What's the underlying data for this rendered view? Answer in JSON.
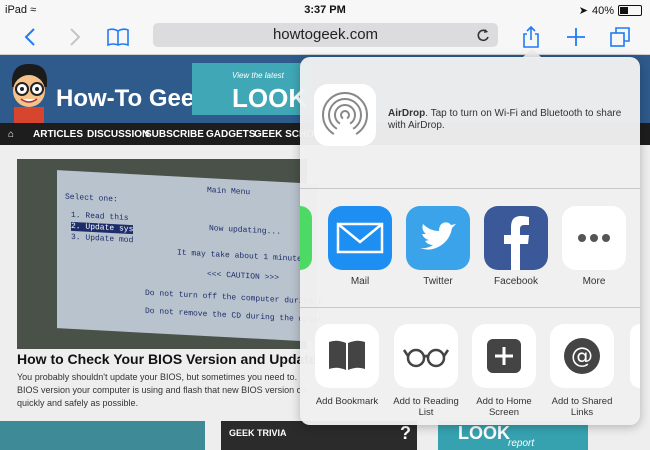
{
  "status": {
    "device": "iPad",
    "time": "3:37 PM",
    "battery": "40%",
    "battery_level": 0.4
  },
  "browser": {
    "url": "howtogeek.com",
    "icons": [
      "chevron-left-icon",
      "chevron-right-icon",
      "bookmarks-icon",
      "reload-icon",
      "share-icon",
      "plus-icon",
      "tabs-icon"
    ]
  },
  "site": {
    "logo": "How-To Geek",
    "banner_small": "View the latest",
    "banner_big": "LOOK",
    "menu": [
      "ARTICLES",
      "DISCUSSION",
      "SUBSCRIBE",
      "GADGETS",
      "GEEK SCHOOL"
    ],
    "article_title": "How to Check Your BIOS Version and Update it",
    "article_body": "You probably shouldn't update your BIOS, but sometimes you need to. BIOS version your computer is using and flash that new BIOS version on quickly and safely as possible.",
    "trivia_label": "GEEK TRIVIA",
    "trivia_mark": "?",
    "promo_title": "LOOK",
    "promo_sub": "report",
    "screen_lines": [
      "Main Menu",
      "Select one:",
      "1. Read this",
      "2. Update sys",
      "3. Update mod",
      "Now updating...",
      "It may take about 1 minute.",
      "<<< CAUTION >>>",
      "Do not turn off the computer during t",
      "Do not remove the CD during the updat"
    ]
  },
  "share_sheet": {
    "airdrop_title": "AirDrop",
    "airdrop_text": ". Tap to turn on Wi-Fi and Bluetooth to share with AirDrop.",
    "apps": [
      {
        "label": "Mail",
        "color": "#1d8ff2"
      },
      {
        "label": "Twitter",
        "color": "#3aa3e9"
      },
      {
        "label": "Facebook",
        "color": "#3b5998"
      },
      {
        "label": "More",
        "color": "#ffffff"
      }
    ],
    "actions": [
      {
        "label": "Add Bookmark"
      },
      {
        "label": "Add to Reading List"
      },
      {
        "label": "Add to Home Screen"
      },
      {
        "label": "Add to Shared Links"
      }
    ]
  }
}
